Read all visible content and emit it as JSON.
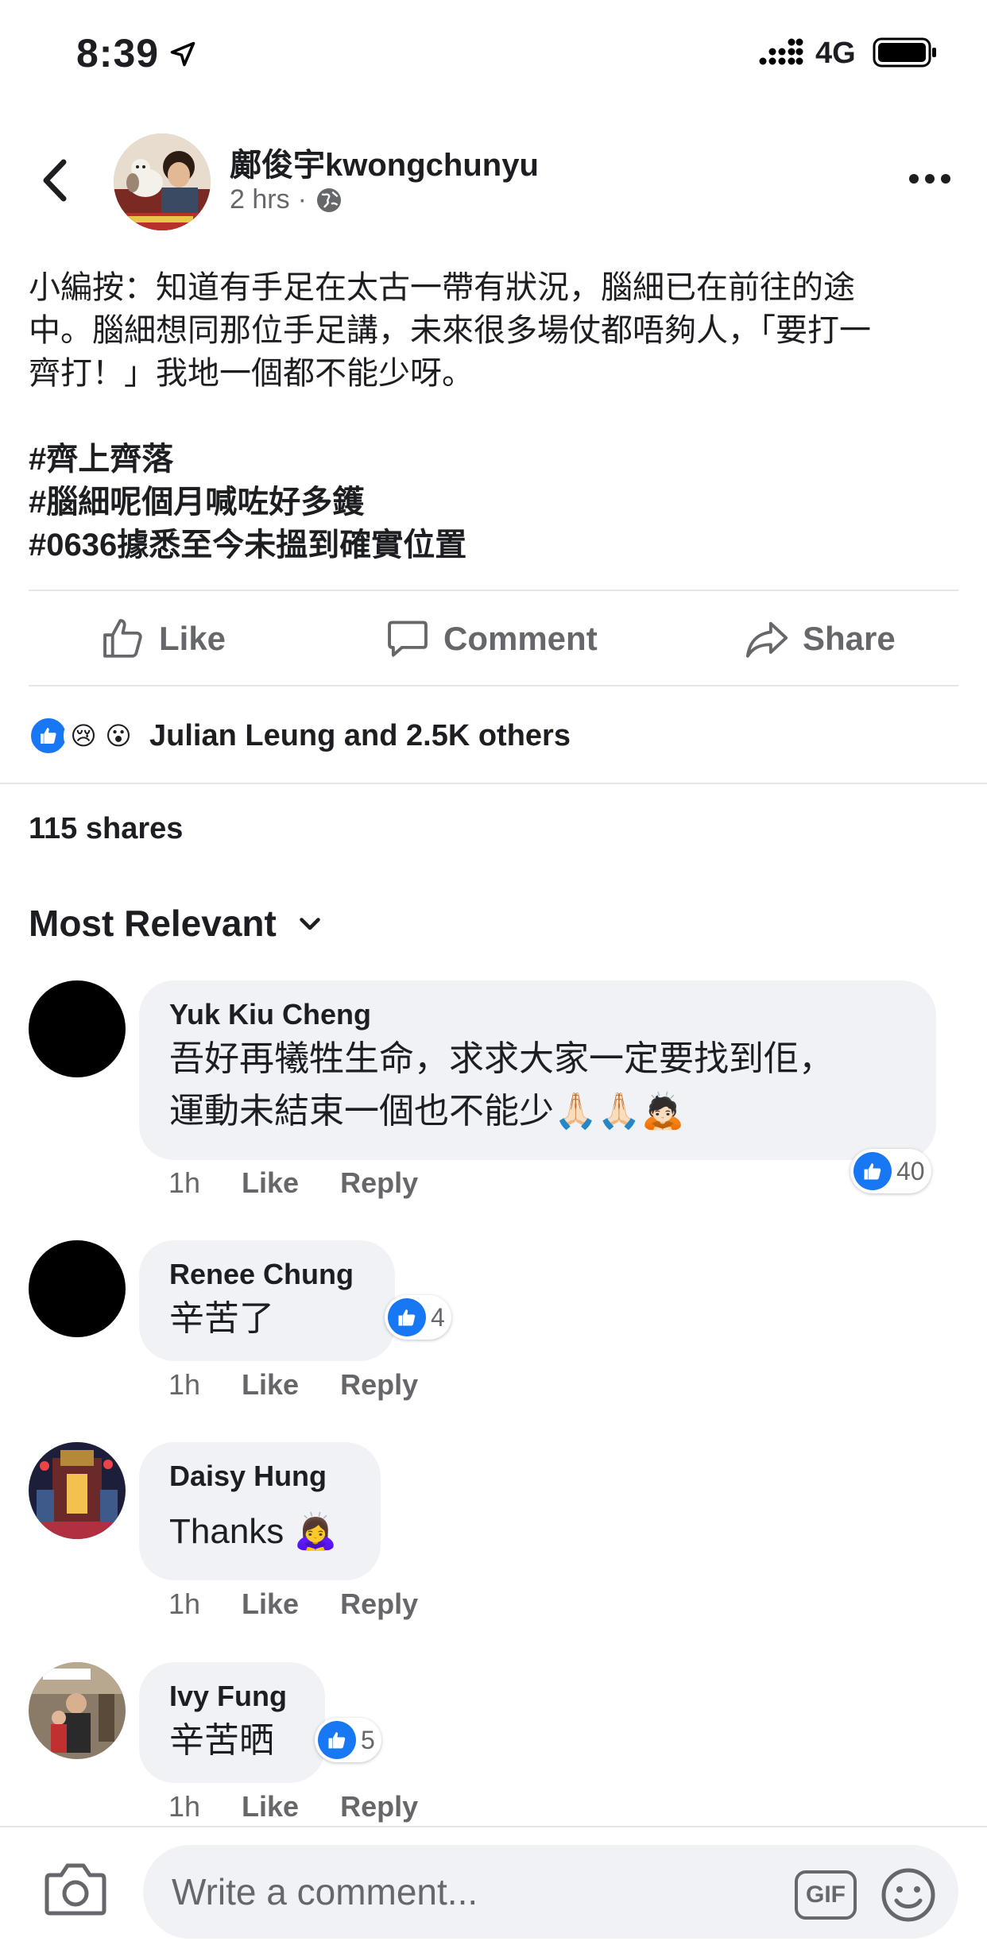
{
  "status_bar": {
    "time": "8:39",
    "network": "4G"
  },
  "post": {
    "author": "鄺俊宇kwongchunyu",
    "time": "2 hrs",
    "separator": "·",
    "lines": [
      "小編按：知道有手足在太古一帶有狀況，腦細已在前往的途",
      "中。腦細想同那位手足講，未來很多場仗都唔夠人，「要打一",
      "齊打！」我地一個都不能少呀。"
    ],
    "hashtags": [
      "#齊上齊落",
      "#腦細呢個月喊咗好多鑊",
      "#0636據悉至今未搵到確實位置"
    ]
  },
  "actions": {
    "like": "Like",
    "comment": "Comment",
    "share": "Share"
  },
  "reactions": {
    "summary": "Julian Leung and 2.5K others",
    "types": [
      "like-icon",
      "sad-icon",
      "wow-icon"
    ]
  },
  "shares": "115 shares",
  "sort": {
    "label": "Most Relevant"
  },
  "comments": [
    {
      "name": "Yuk Kiu Cheng",
      "lines": [
        "吾好再犧牲生命，求求大家一定要找到佢，",
        "運動未結束一個也不能少🙏🏻🙏🏻🙇🏻"
      ],
      "time": "1h",
      "like": "Like",
      "reply": "Reply",
      "likes": "40"
    },
    {
      "name": "Renee Chung",
      "lines": [
        "辛苦了"
      ],
      "time": "1h",
      "like": "Like",
      "reply": "Reply",
      "likes": "4"
    },
    {
      "name": "Daisy Hung",
      "lines": [
        "Thanks 🙇‍♀️"
      ],
      "time": "1h",
      "like": "Like",
      "reply": "Reply",
      "likes": ""
    },
    {
      "name": "Ivy Fung",
      "lines": [
        "辛苦晒"
      ],
      "time": "1h",
      "like": "Like",
      "reply": "Reply",
      "likes": "5"
    }
  ],
  "composer": {
    "placeholder": "Write a comment...",
    "gif": "GIF"
  },
  "colors": {
    "accent": "#1877f2",
    "muted": "#65676b",
    "bubble": "#f0f2f5"
  }
}
